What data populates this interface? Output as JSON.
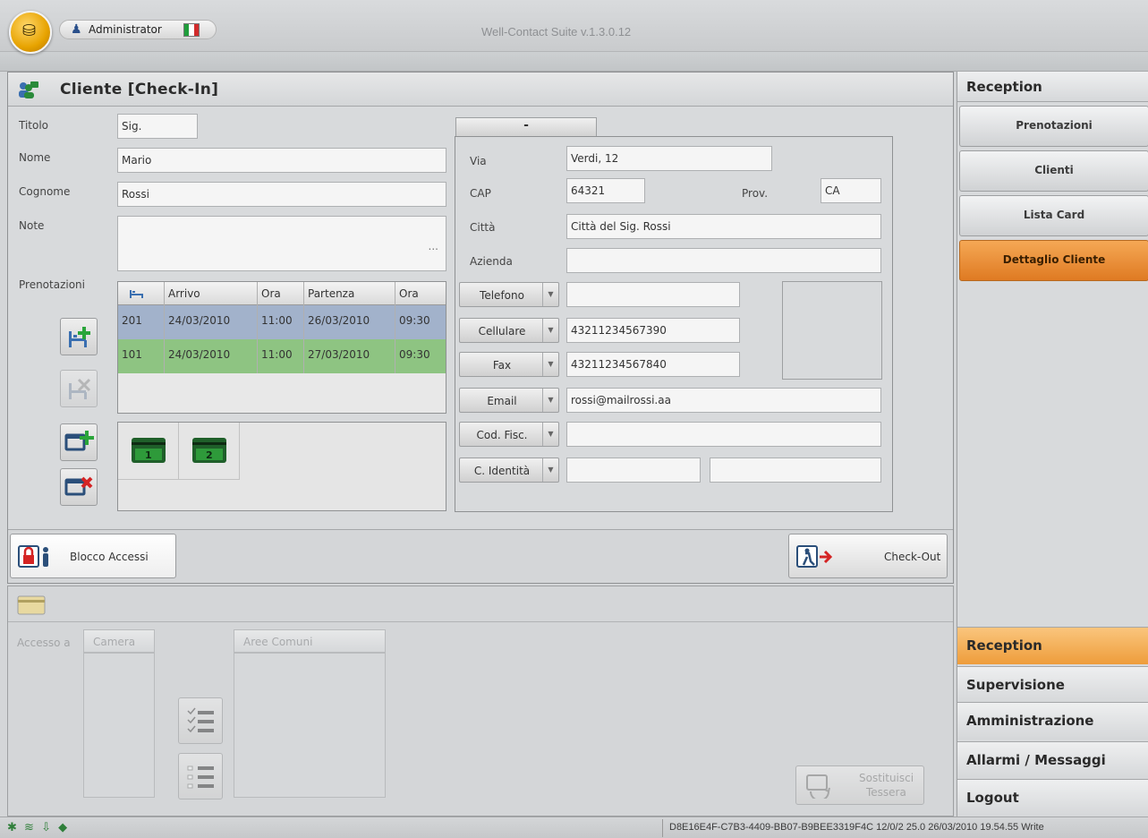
{
  "app": {
    "title": "Well-Contact Suite v.1.3.0.12",
    "user": "Administrator"
  },
  "panel": {
    "title": "Cliente [Check-In]"
  },
  "client": {
    "titolo_label": "Titolo",
    "titolo_value": "Sig.",
    "nome_label": "Nome",
    "nome_value": "Mario",
    "cognome_label": "Cognome",
    "cognome_value": "Rossi",
    "note_label": "Note",
    "note_value": "",
    "note_more": "...",
    "prenotazioni_label": "Prenotazioni"
  },
  "bookings": {
    "columns": [
      "",
      "Arrivo",
      "Ora",
      "Partenza",
      "Ora"
    ],
    "rows": [
      {
        "room": "201",
        "arrivo": "24/03/2010",
        "ora_arrivo": "11:00",
        "partenza": "26/03/2010",
        "ora_partenza": "09:30"
      },
      {
        "room": "101",
        "arrivo": "24/03/2010",
        "ora_arrivo": "11:00",
        "partenza": "27/03/2010",
        "ora_partenza": "09:30"
      }
    ]
  },
  "cards": [
    "1",
    "2"
  ],
  "address": {
    "tab_label": "-",
    "via_label": "Via",
    "via_value": "Verdi, 12",
    "cap_label": "CAP",
    "cap_value": "64321",
    "prov_label": "Prov.",
    "prov_value": "CA",
    "citta_label": "Città",
    "citta_value": "Città del Sig. Rossi",
    "azienda_label": "Azienda",
    "azienda_value": ""
  },
  "contacts": [
    {
      "label": "Telefono",
      "value": ""
    },
    {
      "label": "Cellulare",
      "value": "43211234567390"
    },
    {
      "label": "Fax",
      "value": "43211234567840"
    },
    {
      "label": "Email",
      "value": "rossi@mailrossi.aa"
    },
    {
      "label": "Cod. Fisc.",
      "value": ""
    },
    {
      "label": "C. Identità",
      "value": "",
      "value2": ""
    }
  ],
  "actions": {
    "blocco_accessi": "Blocco Accessi",
    "check_out": "Check-Out"
  },
  "access": {
    "accesso_label": "Accesso a",
    "camera_header": "Camera",
    "aree_header": "Aree Comuni",
    "sostituisci_line1": "Sostituisci",
    "sostituisci_line2": "Tessera"
  },
  "nav": {
    "header": "Reception",
    "items": [
      "Prenotazioni",
      "Clienti",
      "Lista Card",
      "Dettaglio Cliente"
    ],
    "active_item": "Dettaglio Cliente",
    "sections": [
      "Reception",
      "Supervisione",
      "Amministrazione",
      "Allarmi / Messaggi",
      "Logout"
    ],
    "active_section": "Reception"
  },
  "status": {
    "text": "D8E16E4F-C7B3-4409-BB07-B9BEE3319F4C 12/0/2 25.0 26/03/2010 19.54.55 Write"
  },
  "colors": {
    "accent_orange": "#ee9d3b",
    "row_blue": "#a2b2cb",
    "row_green": "#8ec482",
    "card_green": "#2e8b2e"
  }
}
